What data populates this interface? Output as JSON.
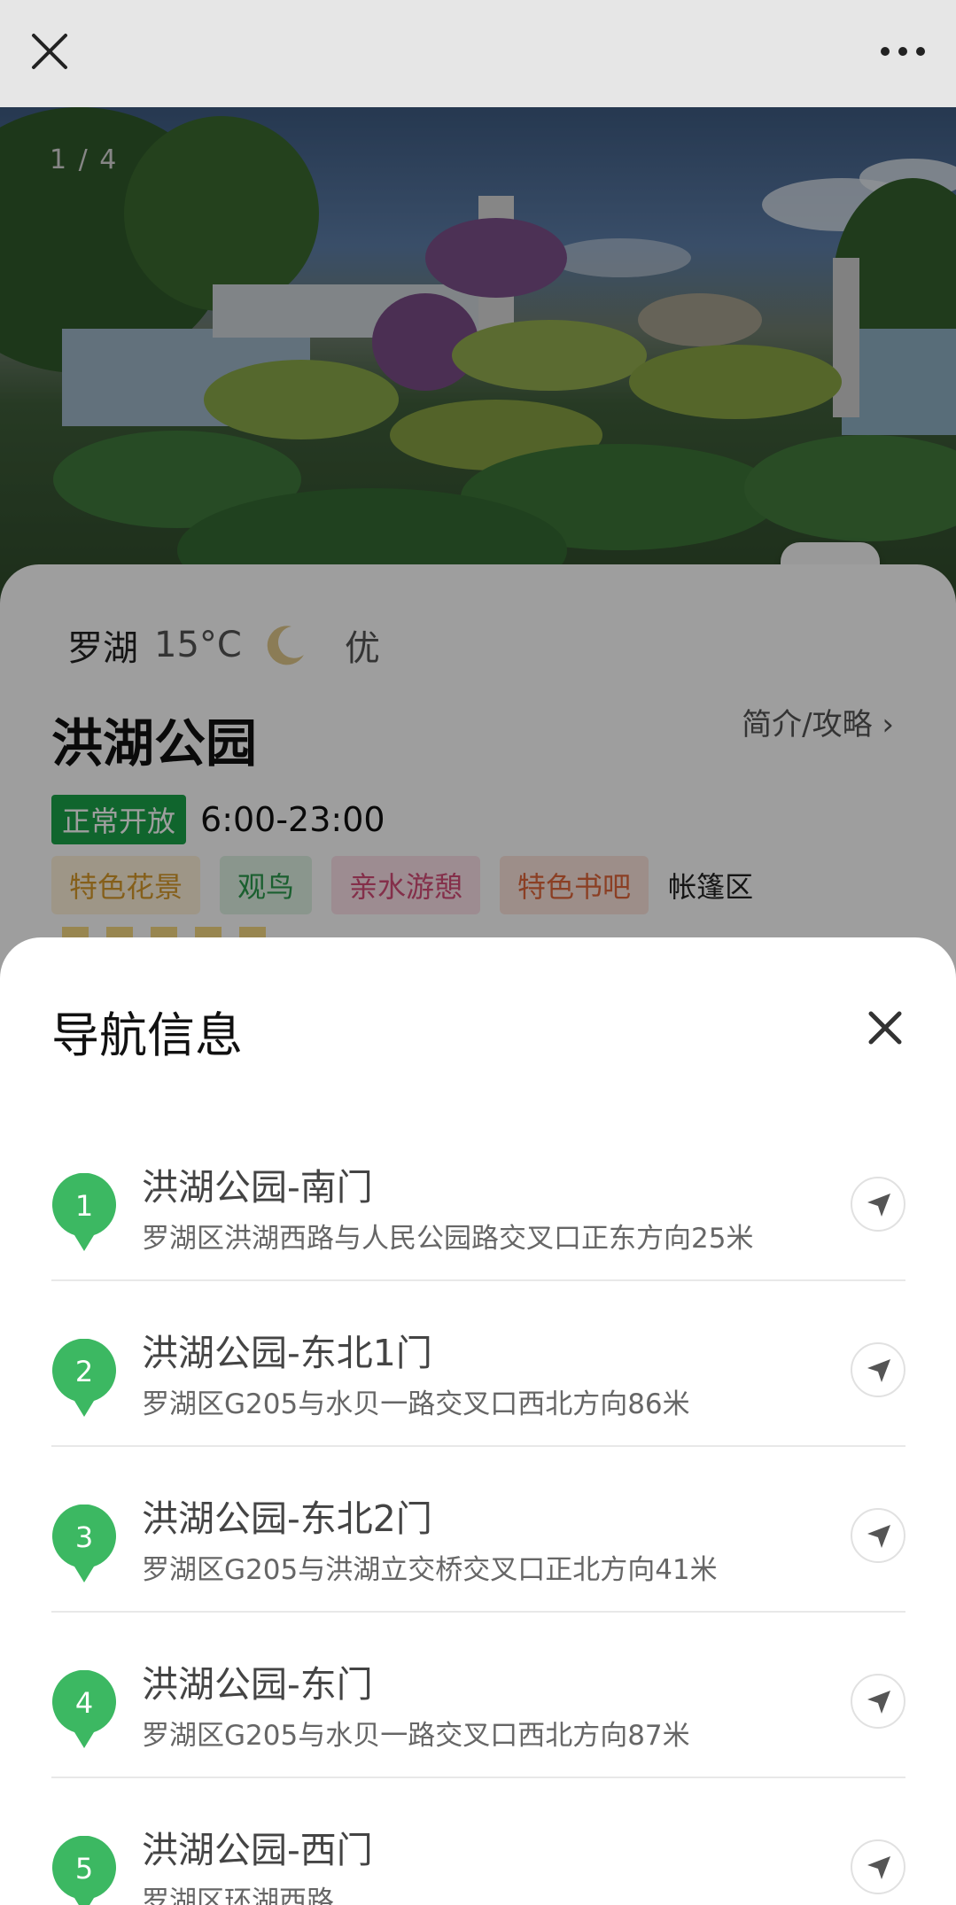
{
  "topbar": {
    "close_icon": "close-icon",
    "more_icon": "more-dots-icon"
  },
  "hero": {
    "counter": "1 / 4"
  },
  "weather": {
    "district": "罗湖",
    "temp": "15°C",
    "icon": "moon-icon",
    "aqi": "优"
  },
  "park": {
    "title": "洪湖公园",
    "guide_link": "简介/攻略 ›",
    "status": "正常开放",
    "hours": "6:00-23:00",
    "tags": [
      {
        "label": "特色花景",
        "bg": "#fff3da",
        "fg": "#d79a2b"
      },
      {
        "label": "观鸟",
        "bg": "#dff3e4",
        "fg": "#2b9a4c"
      },
      {
        "label": "亲水游憩",
        "bg": "#fde2ea",
        "fg": "#d64d78"
      },
      {
        "label": "特色书吧",
        "bg": "#fde6dd",
        "fg": "#e0673b"
      },
      {
        "label": "帐篷区",
        "bg": "transparent",
        "fg": "#222222"
      }
    ]
  },
  "sheet": {
    "title": "导航信息",
    "items": [
      {
        "num": "1",
        "name": "洪湖公园-南门",
        "addr": "罗湖区洪湖西路与人民公园路交叉口正东方向25米"
      },
      {
        "num": "2",
        "name": "洪湖公园-东北1门",
        "addr": "罗湖区G205与水贝一路交叉口西北方向86米"
      },
      {
        "num": "3",
        "name": "洪湖公园-东北2门",
        "addr": "罗湖区G205与洪湖立交桥交叉口正北方向41米"
      },
      {
        "num": "4",
        "name": "洪湖公园-东门",
        "addr": "罗湖区G205与水贝一路交叉口西北方向87米"
      },
      {
        "num": "5",
        "name": "洪湖公园-西门",
        "addr": "罗湖区环湖西路"
      }
    ]
  },
  "colors": {
    "accent_green": "#1aa34a",
    "pin_green": "#3cb862"
  }
}
